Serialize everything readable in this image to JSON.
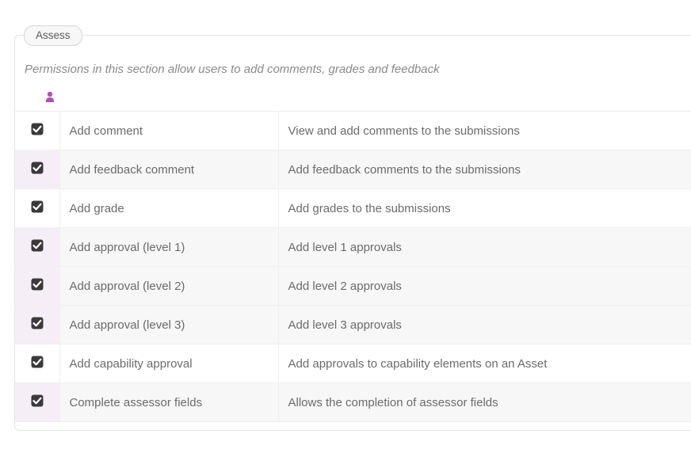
{
  "tab": {
    "label": "Assess"
  },
  "section": {
    "description": "Permissions in this section allow users to add comments, grades and feedback"
  },
  "permissions": [
    {
      "checked": true,
      "label": "Add comment",
      "description": "View and add comments to the submissions",
      "highlighted": false
    },
    {
      "checked": true,
      "label": "Add feedback comment",
      "description": "Add feedback comments to the submissions",
      "highlighted": true
    },
    {
      "checked": true,
      "label": "Add grade",
      "description": "Add grades to the submissions",
      "highlighted": false
    },
    {
      "checked": true,
      "label": "Add approval (level 1)",
      "description": "Add level 1 approvals",
      "highlighted": true
    },
    {
      "checked": true,
      "label": "Add approval (level 2)",
      "description": "Add level 2 approvals",
      "highlighted": true
    },
    {
      "checked": true,
      "label": "Add approval (level 3)",
      "description": "Add level 3 approvals",
      "highlighted": true
    },
    {
      "checked": true,
      "label": "Add capability approval",
      "description": "Add approvals to capability elements on an Asset",
      "highlighted": false
    },
    {
      "checked": true,
      "label": "Complete assessor fields",
      "description": "Allows the completion of assessor fields",
      "highlighted": true
    }
  ],
  "icons": {
    "person_color": "#b24fbb",
    "check_bg": "#3a3a3a",
    "check_tick": "#ffffff"
  }
}
